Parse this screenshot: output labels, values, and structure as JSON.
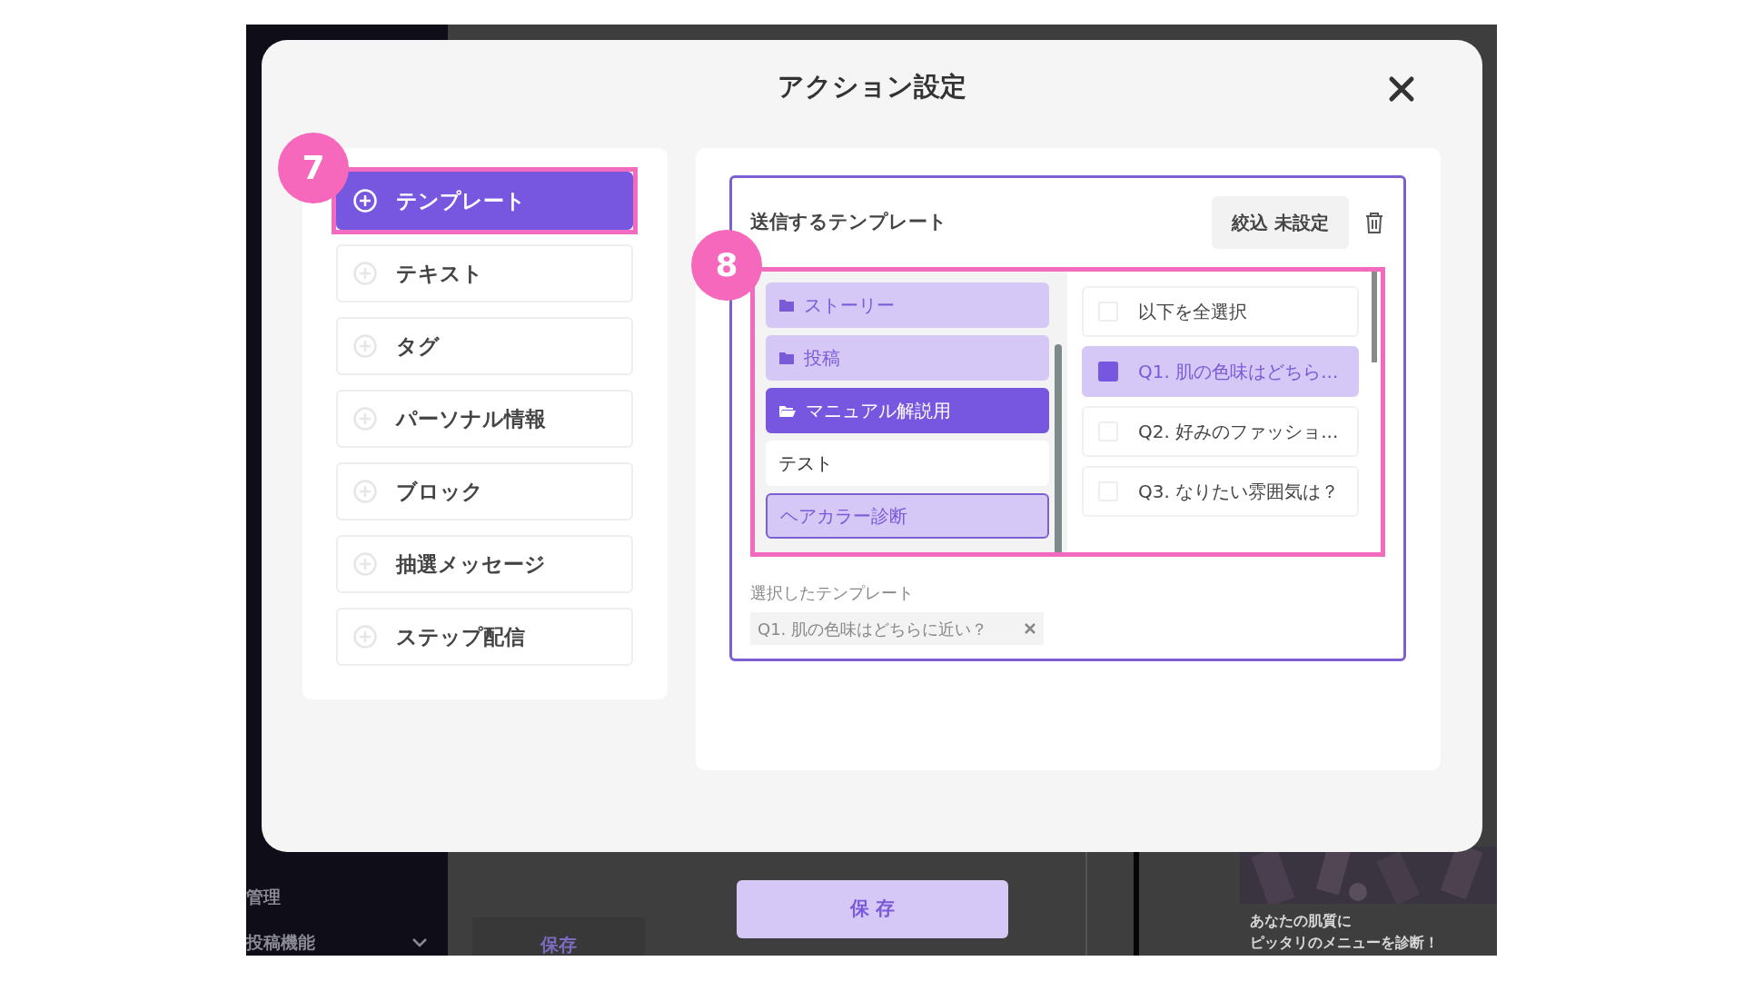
{
  "background": {
    "sidebar_sections": [
      "管理",
      "投稿機能"
    ],
    "save_button": "保存",
    "promo_text": [
      "あなたの肌質に",
      "ピッタリのメニューを診断！"
    ]
  },
  "modal": {
    "title": "アクション設定",
    "action_types": [
      {
        "label": "テンプレート",
        "selected": true,
        "annotation": "7"
      },
      {
        "label": "テキスト",
        "selected": false
      },
      {
        "label": "タグ",
        "selected": false
      },
      {
        "label": "パーソナル情報",
        "selected": false
      },
      {
        "label": "ブロック",
        "selected": false
      },
      {
        "label": "抽選メッセージ",
        "selected": false
      },
      {
        "label": "ステップ配信",
        "selected": false
      }
    ],
    "template_panel": {
      "title": "送信するテンプレート",
      "filter_button": "絞込 未設定",
      "annotation": "8",
      "folders": [
        {
          "label": "ストーリー",
          "kind": "folder",
          "selected": false
        },
        {
          "label": "投稿",
          "kind": "folder",
          "selected": false
        },
        {
          "label": "マニュアル解説用",
          "kind": "folder",
          "selected": true
        },
        {
          "label": "テスト",
          "kind": "item",
          "selected": false
        },
        {
          "label": "ヘアカラー診断",
          "kind": "group",
          "selected": false
        }
      ],
      "templates": [
        {
          "label": "以下を全選択",
          "checked": false
        },
        {
          "label": "Q1. 肌の色味はどちら...",
          "checked": true
        },
        {
          "label": "Q2. 好みのファッショ...",
          "checked": false
        },
        {
          "label": "Q3. なりたい雰囲気は？",
          "checked": false
        }
      ],
      "selected_label": "選択したテンプレート",
      "selected_chips": [
        "Q1. 肌の色味はどちらに近い？"
      ]
    }
  },
  "save_button": "保 存"
}
